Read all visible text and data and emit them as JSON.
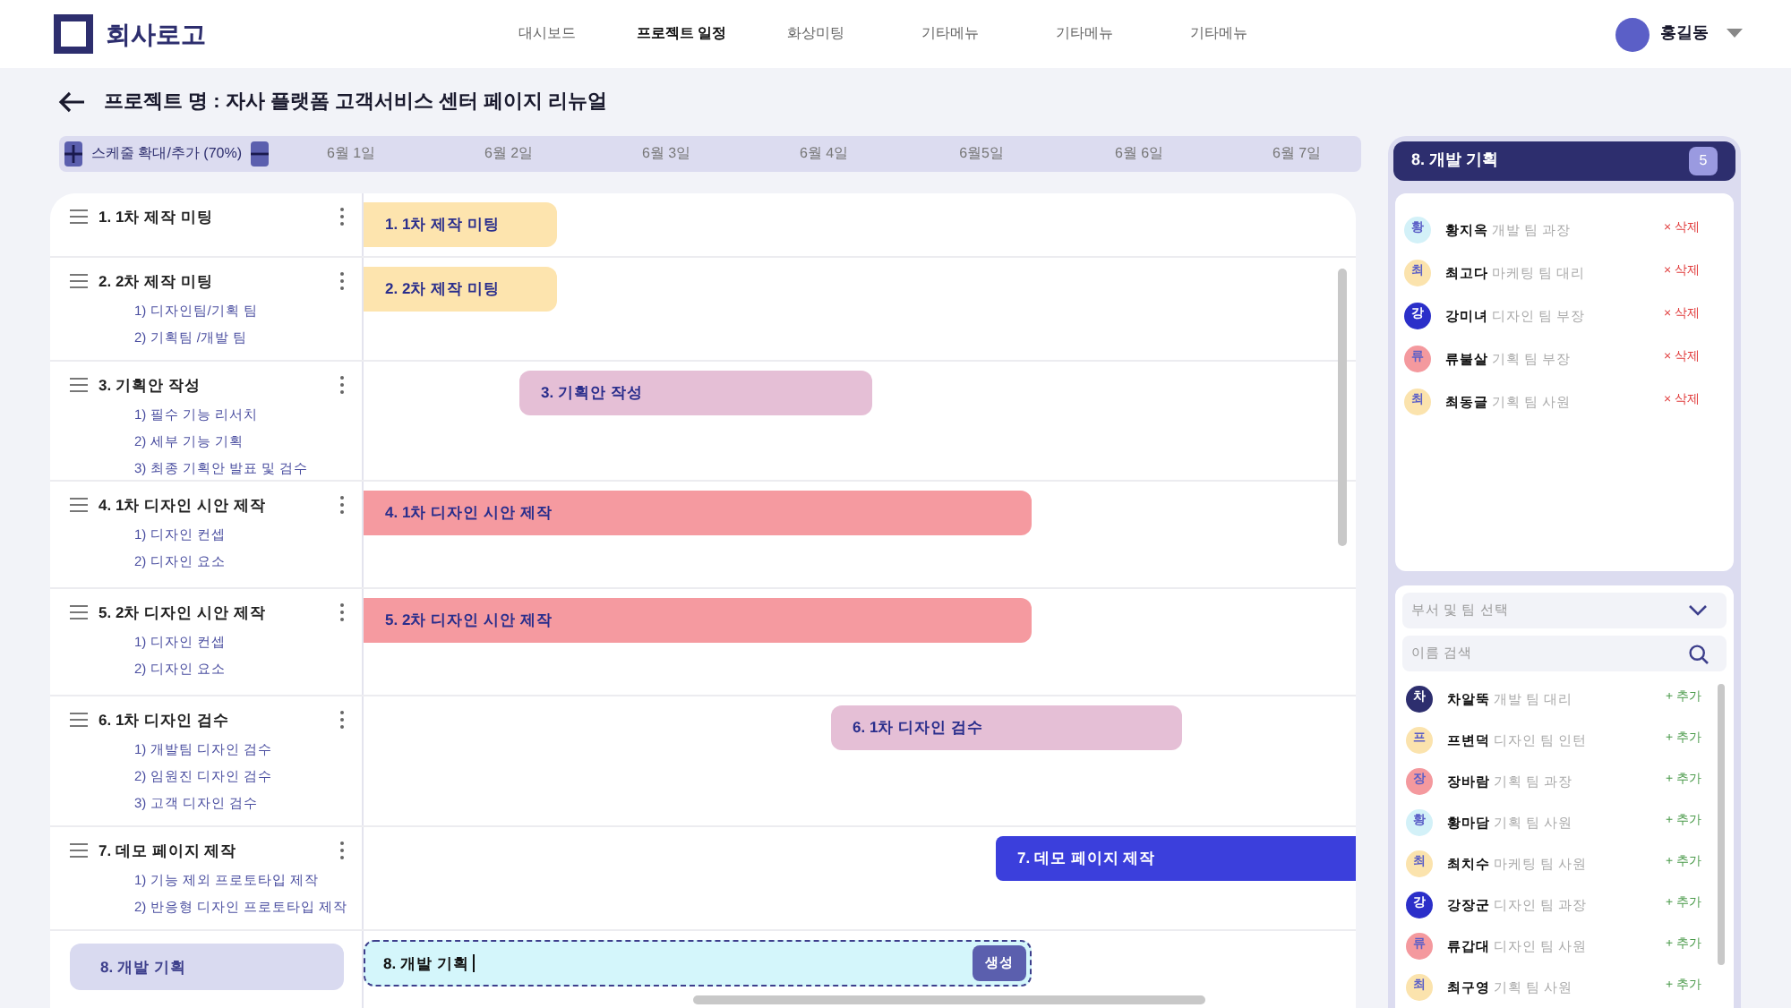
{
  "header": {
    "logo_text": "회사로고",
    "nav": [
      {
        "label": "대시보드",
        "selected": false
      },
      {
        "label": "프로젝트 일정",
        "selected": true
      },
      {
        "label": "화상미팅",
        "selected": false
      },
      {
        "label": "기타메뉴",
        "selected": false
      },
      {
        "label": "기타메뉴",
        "selected": false
      },
      {
        "label": "기타메뉴",
        "selected": false
      }
    ],
    "user": {
      "name": "홍길동"
    }
  },
  "project_title": "프로젝트 명 : 자사 플랫폼 고객서비스 센터 페이지 리뉴얼",
  "timeline": {
    "zoom_label": "스케줄 확대/추가 (70%)",
    "days": [
      "6월 1일",
      "6월 2일",
      "6월 3일",
      "6월 4일",
      "6월5일",
      "6월 6일",
      "6월 7일"
    ]
  },
  "tasks": [
    {
      "kind": "task",
      "title": "1. 1차 제작 미팅",
      "selected": false,
      "bar_label": "1. 1차 제작 미팅",
      "color": "#fde4ae"
    },
    {
      "kind": "task",
      "title": "2. 2차 제작 미팅",
      "selected": false,
      "subtasks": [
        "1) 디자인팀/기획 팀",
        "2) 기획팀 /개발 팀"
      ],
      "bar_label": "2. 2차 제작 미팅",
      "color": "#fde4ae"
    },
    {
      "kind": "task",
      "title": "3. 기획안 작성",
      "selected": false,
      "subtasks": [
        "1) 필수 기능 리서치",
        "2) 세부 기능 기획",
        "3) 최종 기획안 발표 및 검수"
      ],
      "bar_label": "3. 기획안 작성",
      "color": "#e5bfd6"
    },
    {
      "kind": "task",
      "title": "4. 1차 디자인 시안 제작",
      "selected": false,
      "subtasks": [
        "1) 디자인 컨셉",
        "2) 디자인 요소"
      ],
      "bar_label": "4. 1차 디자인 시안 제작",
      "color": "#f59aa0"
    },
    {
      "kind": "task",
      "title": "5. 2차 디자인 시안 제작",
      "selected": false,
      "subtasks": [
        "1) 디자인 컨셉",
        "2) 디자인 요소"
      ],
      "bar_label": "5. 2차 디자인 시안 제작",
      "color": "#f59aa0"
    },
    {
      "kind": "task",
      "title": "6. 1차 디자인 검수",
      "selected": false,
      "subtasks": [
        "1) 개발팀 디자인 검수",
        "2) 임원진 디자인 검수",
        "3) 고객 디자인 검수"
      ],
      "bar_label": "6. 1차 디자인 검수",
      "color": "#e5bfd6"
    },
    {
      "kind": "task",
      "title": "7. 데모 페이지 제작",
      "selected": false,
      "subtasks": [
        "1) 기능 제외 프로토타입 제작",
        "2) 반응형 디자인 프로토타입 제작"
      ],
      "bar_label": "7. 데모 페이지 제작",
      "color": "#3b3fdc"
    },
    {
      "kind": "new",
      "title": "8. 개발 기획",
      "selected": true,
      "input_value": "8. 개발 기획",
      "button": "생성"
    }
  ],
  "team": {
    "title": "8. 개발 기획",
    "count": "5",
    "members": [
      {
        "initial": "황",
        "name": "황지옥",
        "role": "개발 팀 과장",
        "color": "#d3f1f8",
        "action": "× 삭제"
      },
      {
        "initial": "최",
        "name": "최고다",
        "role": "마케팅 팀 대리",
        "color": "#fbe3ad",
        "action": "× 삭제"
      },
      {
        "initial": "강",
        "name": "강미녀",
        "role": "디자인 팀 부장",
        "color": "#2b2fc9",
        "action": "× 삭제"
      },
      {
        "initial": "류",
        "name": "류불살",
        "role": "기획 팀 부장",
        "color": "#f4999e",
        "action": "× 삭제"
      },
      {
        "initial": "최",
        "name": "최동글",
        "role": "기획 팀 사원",
        "color": "#fbe3ad",
        "action": "× 삭제"
      }
    ]
  },
  "directory": {
    "department_select": {
      "placeholder": "부서 및 팀 선택"
    },
    "name_search": {
      "placeholder": "이름 검색"
    },
    "people": [
      {
        "initial": "차",
        "name": "차알뚝",
        "role": "개발 팀 대리",
        "color": "#2d2e6e",
        "action": "+ 추가"
      },
      {
        "initial": "프",
        "name": "프변덕",
        "role": "디자인 팀 인턴",
        "color": "#fbe3ad",
        "action": "+ 추가"
      },
      {
        "initial": "장",
        "name": "장바람",
        "role": "기획 팀 과장",
        "color": "#f4999e",
        "action": "+ 추가"
      },
      {
        "initial": "황",
        "name": "황마담",
        "role": "기획 팀 사원",
        "color": "#d3f1f8",
        "action": "+ 추가"
      },
      {
        "initial": "최",
        "name": "최치수",
        "role": "마케팅 팀 사원",
        "color": "#fbe3ad",
        "action": "+ 추가"
      },
      {
        "initial": "강",
        "name": "강장군",
        "role": "디자인 팀 과장",
        "color": "#2b2fc9",
        "action": "+ 추가"
      },
      {
        "initial": "류",
        "name": "류갑대",
        "role": "디자인 팀 사원",
        "color": "#f4999e",
        "action": "+ 추가"
      },
      {
        "initial": "최",
        "name": "최구영",
        "role": "기획 팀 사원",
        "color": "#fbe3ad",
        "action": "+ 추가"
      }
    ]
  }
}
